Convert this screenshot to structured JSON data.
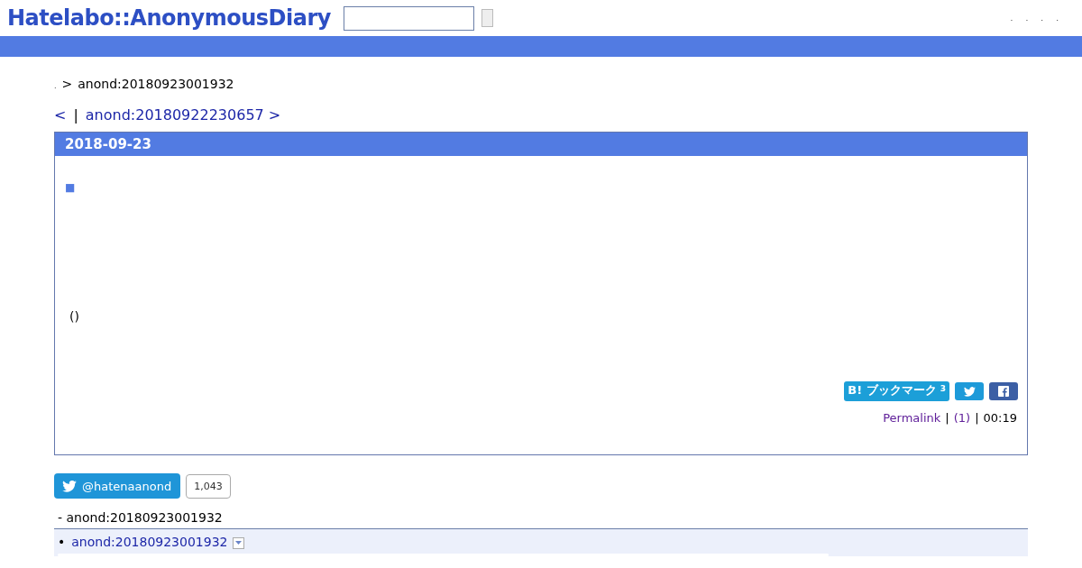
{
  "header": {
    "logo": "Hatelabo::AnonymousDiary",
    "links": [
      ".",
      ".",
      ".",
      "."
    ]
  },
  "breadcrumb": {
    "home": ".",
    "separator": ">",
    "current": "anond:20180923001932"
  },
  "pager": {
    "prev": "<",
    "separator": "|",
    "next": "anond:20180922230657 >"
  },
  "entry": {
    "date": "2018-09-23",
    "section_mark": "■",
    "body": "()",
    "bookmark": {
      "label": "B! ブックマーク",
      "count": "3"
    },
    "footer": {
      "permalink": "Permalink",
      "sep1": "|",
      "comments": "(1)",
      "sep2": "|",
      "time": "00:19"
    }
  },
  "twitter": {
    "handle": "@hatenaanond",
    "followers": "1,043"
  },
  "references": {
    "title": "-  anond:20180923001932",
    "items": [
      {
        "marker": "•",
        "link": "anond:20180923001932",
        "expanded": false
      }
    ]
  }
}
